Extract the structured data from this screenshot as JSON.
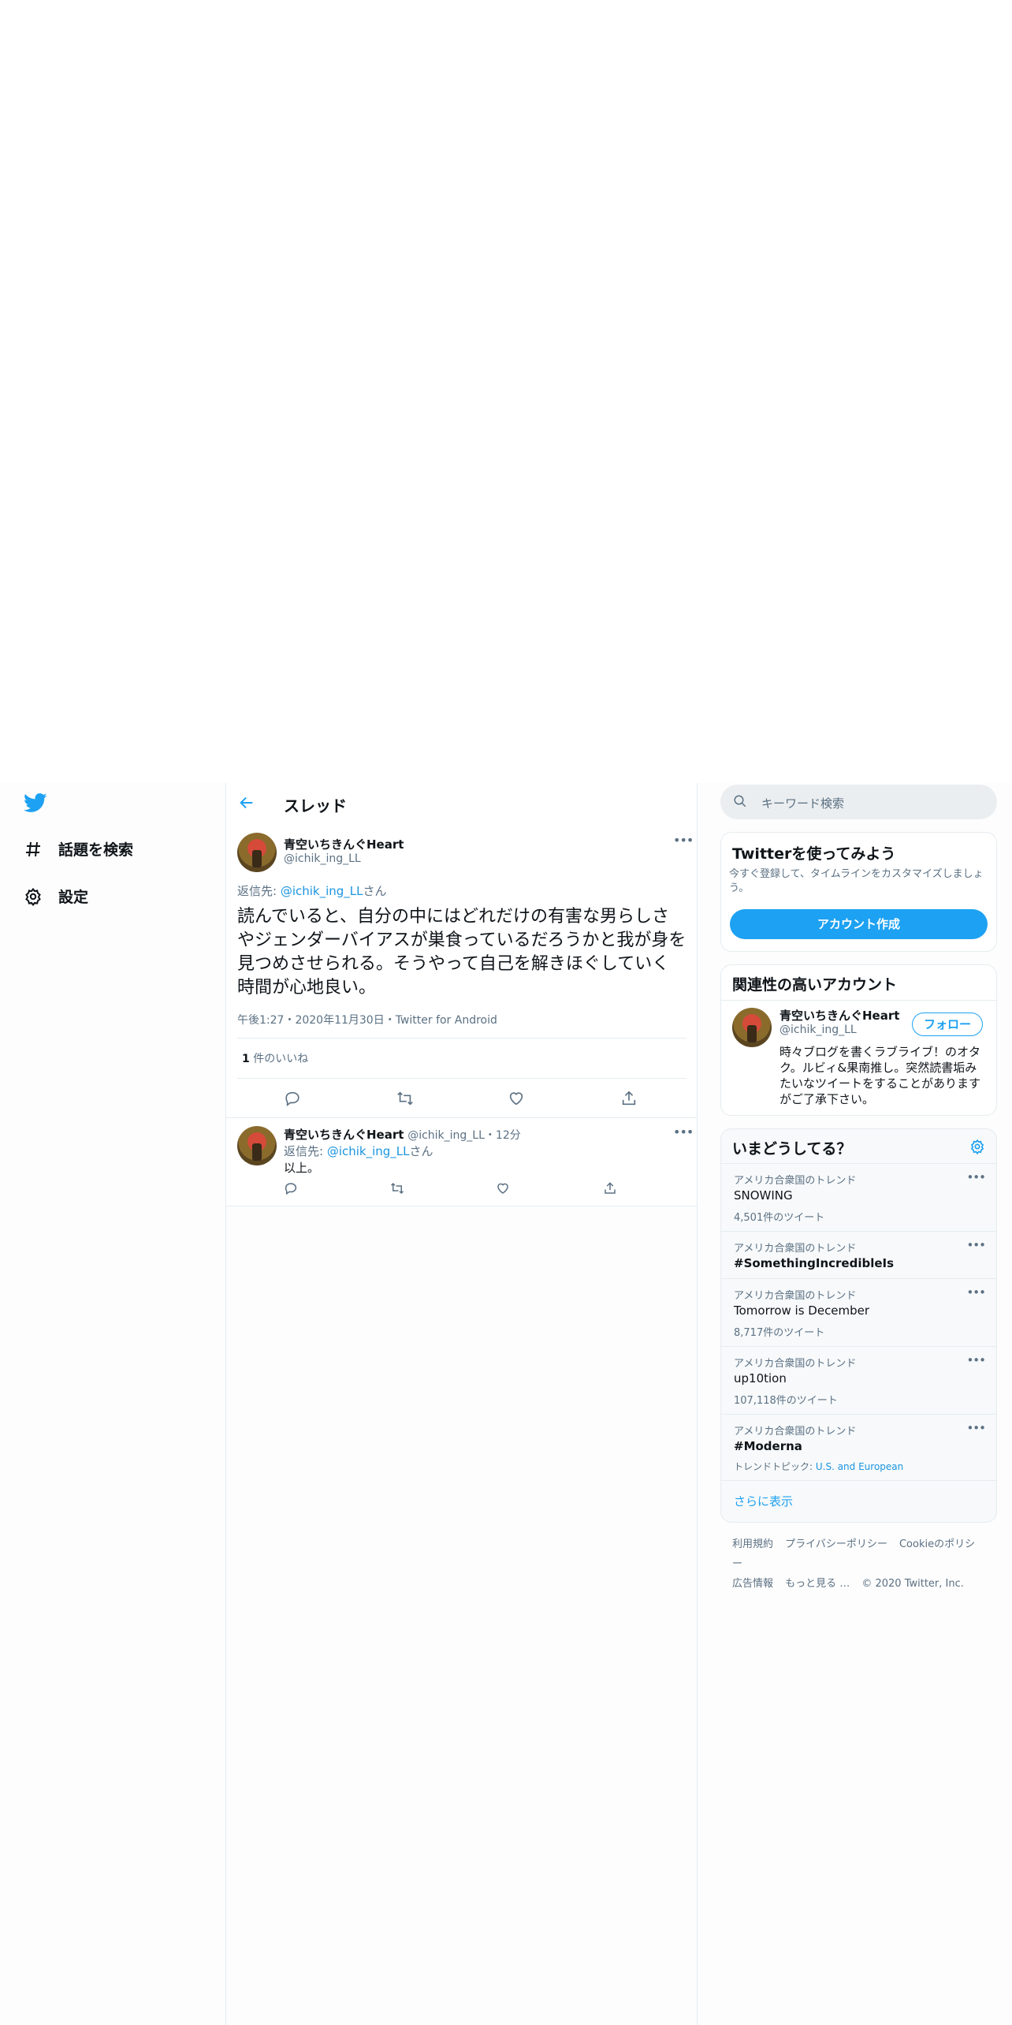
{
  "colors": {
    "accent": "#1da1f2",
    "link": "#1b95e0",
    "text": "#0f1419",
    "muted": "#5b7083",
    "border": "#e6ecf0"
  },
  "nav": {
    "logo_icon": "twitter-bird-icon",
    "items": [
      {
        "icon": "hashtag-icon",
        "label": "話題を検索"
      },
      {
        "icon": "gear-icon",
        "label": "設定"
      }
    ]
  },
  "header": {
    "back_icon": "arrow-left-icon",
    "title": "スレッド"
  },
  "main_tweet": {
    "display_name": "青空いちきんぐHeart",
    "handle": "@ichik_ing_LL",
    "reply_prefix": "返信先: ",
    "reply_to": "@ichik_ing_LL",
    "reply_suffix": "さん",
    "text": "読んでいると、自分の中にはどれだけの有害な男らしさやジェンダーバイアスが巣食っているだろうかと我が身を見つめさせられる。そうやって自己を解きほぐしていく時間が心地良い。",
    "timestamp": "午後1:27・2020年11月30日・Twitter for Android",
    "likes_count": "1",
    "likes_label": "件のいいね",
    "actions": [
      "reply-icon",
      "retweet-icon",
      "like-icon",
      "share-icon"
    ]
  },
  "reply_tweet": {
    "display_name": "青空いちきんぐHeart",
    "handle": "@ichik_ing_LL",
    "time": "・12分",
    "reply_prefix": "返信先: ",
    "reply_to": "@ichik_ing_LL",
    "reply_suffix": "さん",
    "text": "以上。",
    "actions": [
      "reply-icon",
      "retweet-icon",
      "like-icon",
      "share-icon"
    ]
  },
  "search": {
    "placeholder": "キーワード検索"
  },
  "signup_card": {
    "title": "Twitterを使ってみよう",
    "description": "今すぐ登録して、タイムラインをカスタマイズしましょう。",
    "button": "アカウント作成"
  },
  "related_card": {
    "title": "関連性の高いアカウント",
    "display_name": "青空いちきんぐHeart",
    "handle": "@ichik_ing_LL",
    "follow_button": "フォロー",
    "bio": "時々ブログを書くラブライブ！のオタク。ルビィ&果南推し。突然読書垢みたいなツイートをすることがありますがご了承下さい。"
  },
  "trends_card": {
    "title": "いまどうしてる？",
    "settings_icon": "gear-icon",
    "trends": [
      {
        "context": "アメリカ合衆国のトレンド",
        "title": "SNOWING",
        "count": "4,501件のツイート"
      },
      {
        "context": "アメリカ合衆国のトレンド",
        "title": "#SomethingIncredibleIs",
        "count": ""
      },
      {
        "context": "アメリカ合衆国のトレンド",
        "title": "Tomorrow is December",
        "count": "8,717件のツイート"
      },
      {
        "context": "アメリカ合衆国のトレンド",
        "title": "up10tion",
        "count": "107,118件のツイート"
      },
      {
        "context": "アメリカ合衆国のトレンド",
        "title": "#Moderna",
        "count": "",
        "topic_prefix": "トレンドトピック: ",
        "topic": "U.S. and European"
      }
    ],
    "more": "もっと見る",
    "show_more": "さらに表示"
  },
  "footer": {
    "links": [
      "利用規約",
      "プライバシーポリシー",
      "Cookieのポリシー",
      "広告情報",
      "もっと見る …"
    ],
    "copyright": "© 2020 Twitter, Inc."
  }
}
